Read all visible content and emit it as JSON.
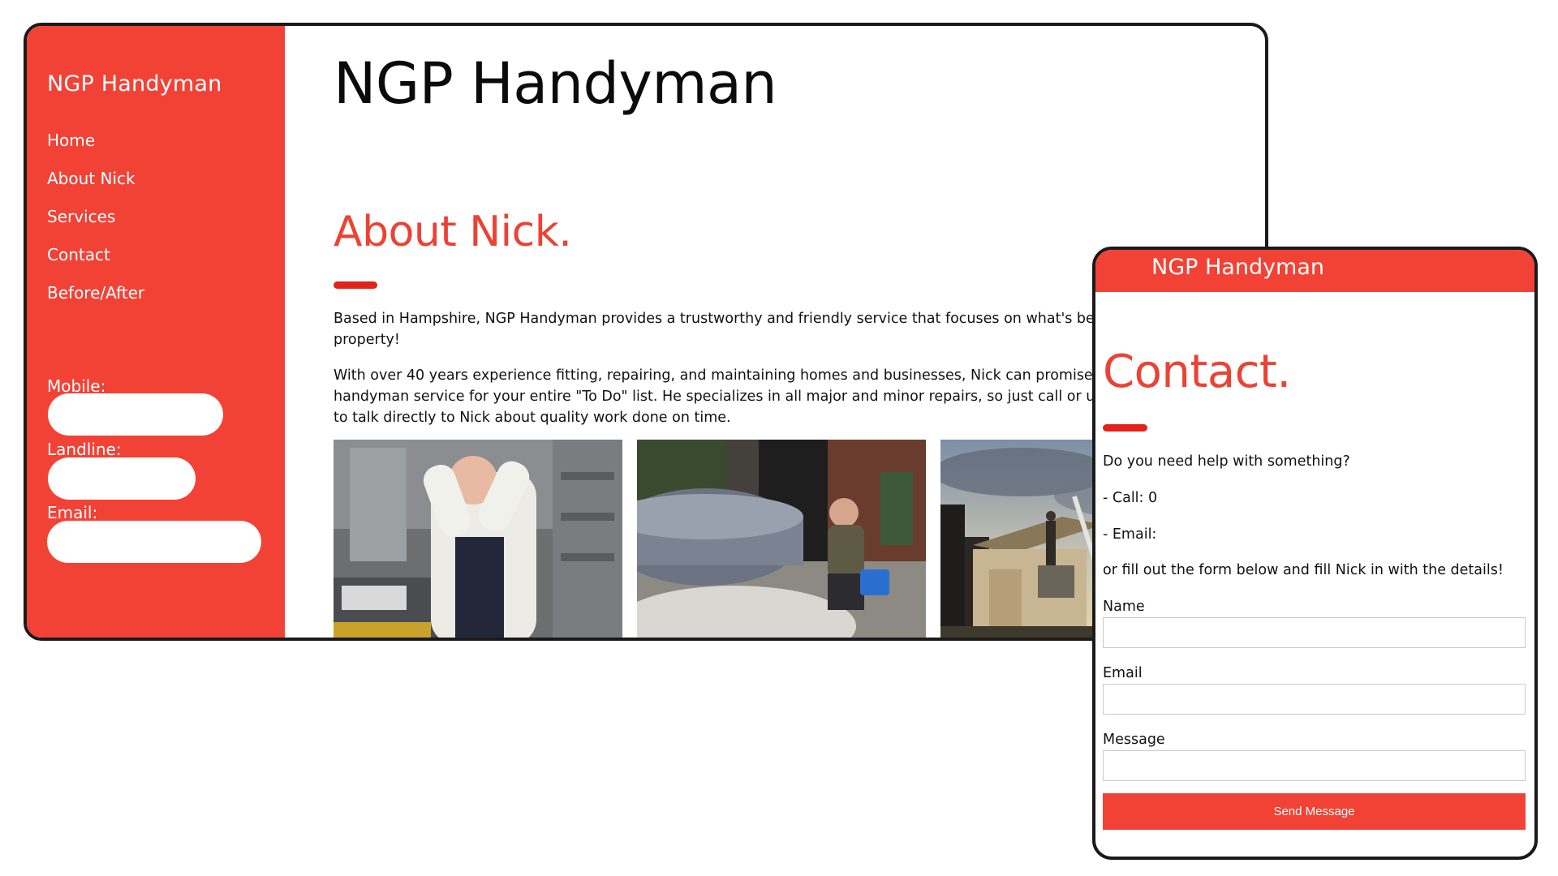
{
  "desktop": {
    "sidebar": {
      "brand": "NGP Handyman",
      "nav": [
        {
          "label": "Home"
        },
        {
          "label": "About Nick"
        },
        {
          "label": "Services"
        },
        {
          "label": "Contact"
        },
        {
          "label": "Before/After"
        }
      ],
      "contact": {
        "mobile_label": "Mobile:",
        "landline_label": "Landline:",
        "email_label": "Email:"
      }
    },
    "main": {
      "title": "NGP Handyman",
      "section_heading": "About Nick.",
      "paragraph1": "Based in Hampshire, NGP Handyman provides a trustworthy and friendly service that focuses on what's best for your property!",
      "paragraph2": "With over 40 years experience fitting, repairing, and maintaining homes and businesses, Nick can promise a reliable handyman service for your entire \"To Do\" list. He specializes in all major and minor repairs, so just call or use the contact form to talk directly to Nick about quality work done on time."
    }
  },
  "mobile": {
    "brand": "NGP Handyman",
    "heading": "Contact.",
    "intro": "Do you need help with something?",
    "call": "- Call: 0",
    "email": "- Email:",
    "form_intro": "or fill out the form below and fill Nick in with the details!",
    "form": {
      "name_label": "Name",
      "email_label": "Email",
      "message_label": "Message",
      "submit_label": "Send Message"
    }
  },
  "colors": {
    "brand_red": "#f24236",
    "heading_red": "#ea4335",
    "accent_rule": "#e2231a"
  }
}
